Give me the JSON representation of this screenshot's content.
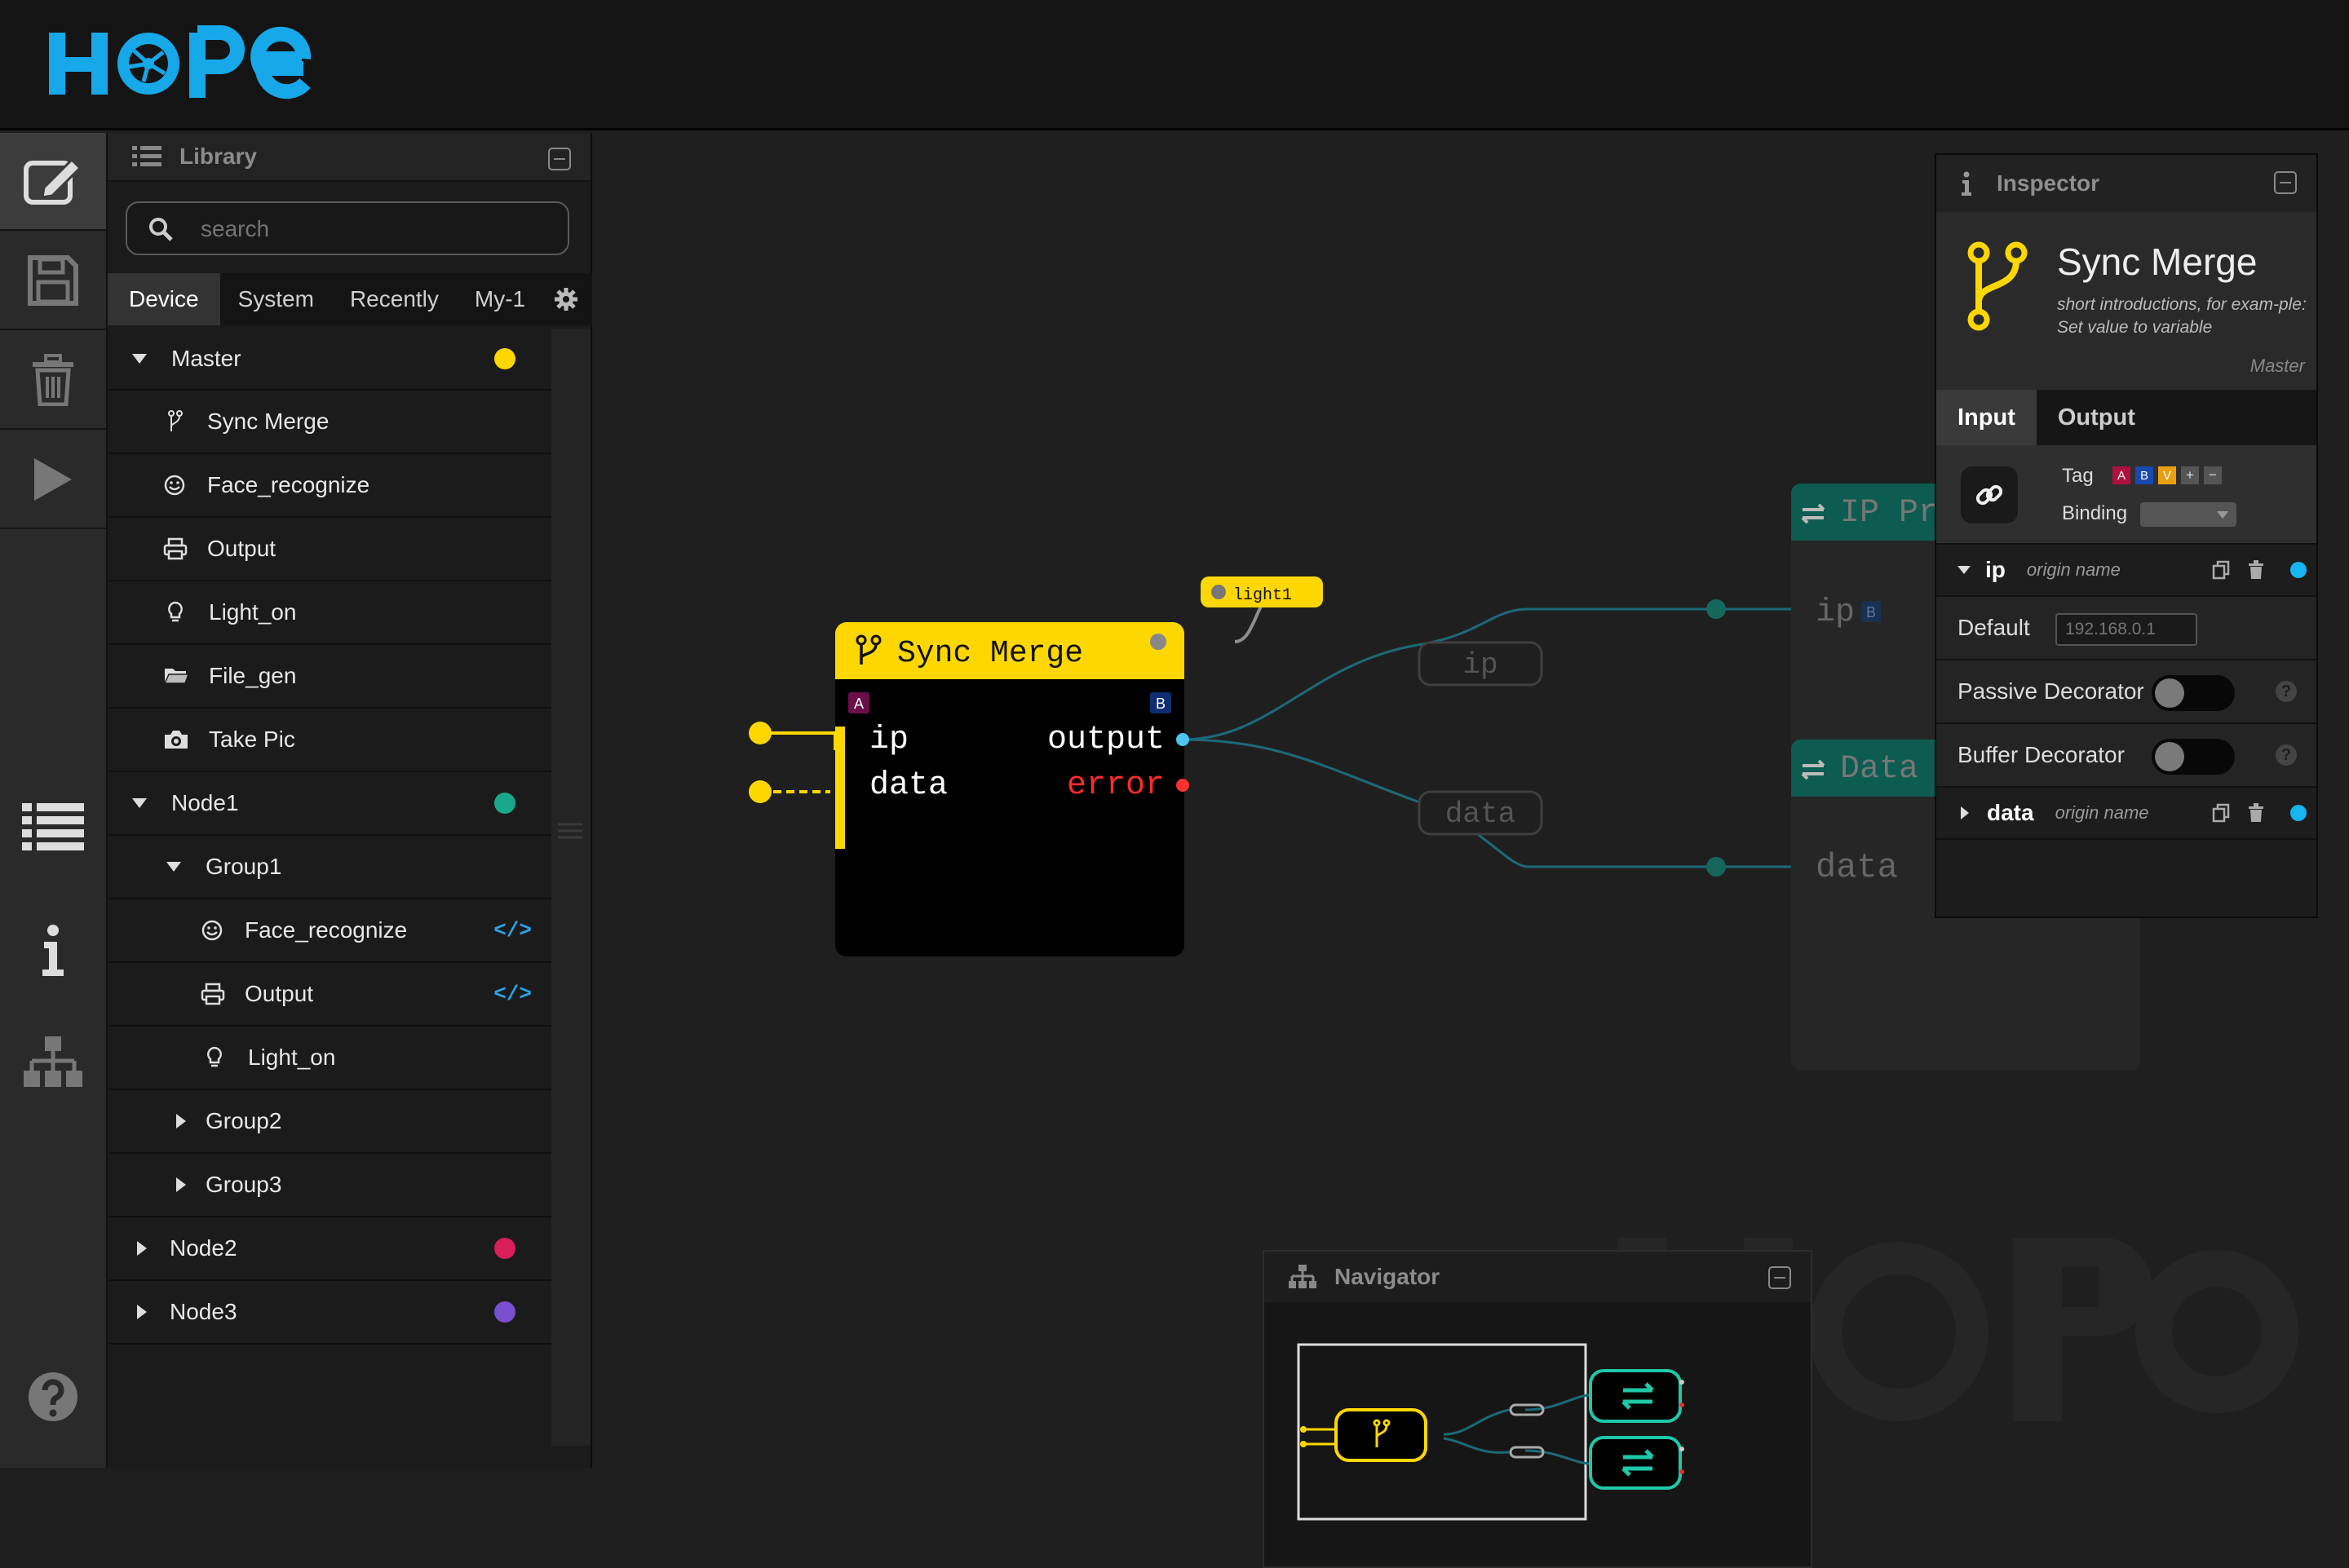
{
  "app": {
    "logo_text": "HOPE",
    "brand_color": "#16a8e8",
    "accent_color": "#ffd700"
  },
  "toolbar": {
    "items": [
      "edit-icon",
      "save-icon",
      "trash-icon",
      "play-icon",
      "list-icon",
      "info-icon",
      "hierarchy-icon",
      "help-icon"
    ]
  },
  "library": {
    "title": "Library",
    "search_placeholder": "search",
    "tabs": [
      "Device",
      "System",
      "Recently",
      "My-1"
    ],
    "tree": [
      {
        "label": "Master",
        "expanded": true,
        "color": "#ffd700"
      },
      {
        "label": "Sync Merge",
        "icon": "merge-icon"
      },
      {
        "label": "Face_recognize",
        "icon": "smile-icon"
      },
      {
        "label": "Output",
        "icon": "printer-icon"
      },
      {
        "label": "Light_on",
        "icon": "bulb-icon"
      },
      {
        "label": "File_gen",
        "icon": "folder-icon"
      },
      {
        "label": "Take Pic",
        "icon": "camera-icon"
      },
      {
        "label": "Node1",
        "expanded": true,
        "color": "#1aa88a"
      },
      {
        "label": "Group1",
        "expanded": true
      },
      {
        "label": "Face_recognize",
        "icon": "smile-icon",
        "code": "</>"
      },
      {
        "label": "Output",
        "icon": "printer-icon",
        "code": "</>"
      },
      {
        "label": "Light_on",
        "icon": "bulb-icon"
      },
      {
        "label": "Group2"
      },
      {
        "label": "Group3"
      },
      {
        "label": "Node2",
        "color": "#d81e5b"
      },
      {
        "label": "Node3",
        "color": "#7a4fd0"
      }
    ]
  },
  "graph": {
    "node": {
      "title": "Sync Merge",
      "badge_a": "A",
      "badge_b": "B",
      "inputs": [
        "ip",
        "data"
      ],
      "outputs": [
        "output",
        "error"
      ]
    },
    "tag_label": "light1",
    "wire_labels": [
      "ip",
      "data"
    ],
    "targets": [
      {
        "title": "IP Pr",
        "port": "ip",
        "badge": "B"
      },
      {
        "title": "Data",
        "port": "data"
      }
    ]
  },
  "navigator": {
    "title": "Navigator"
  },
  "inspector": {
    "title": "Inspector",
    "node_name": "Sync Merge",
    "description": "short introductions, for exam-ple: Set value to variable",
    "category": "Master",
    "tabs": [
      "Input",
      "Output"
    ],
    "tag_label": "Tag",
    "tags": [
      "A",
      "B",
      "V",
      "+",
      "−"
    ],
    "binding_label": "Binding",
    "ports": [
      {
        "name": "ip",
        "origin": "origin name",
        "color": "#16b4f0"
      },
      {
        "name": "data",
        "origin": "origin name",
        "color": "#16b4f0"
      }
    ],
    "default_label": "Default",
    "default_placeholder": "192.168.0.1",
    "passive_label": "Passive Decorator",
    "buffer_label": "Buffer Decorator"
  }
}
